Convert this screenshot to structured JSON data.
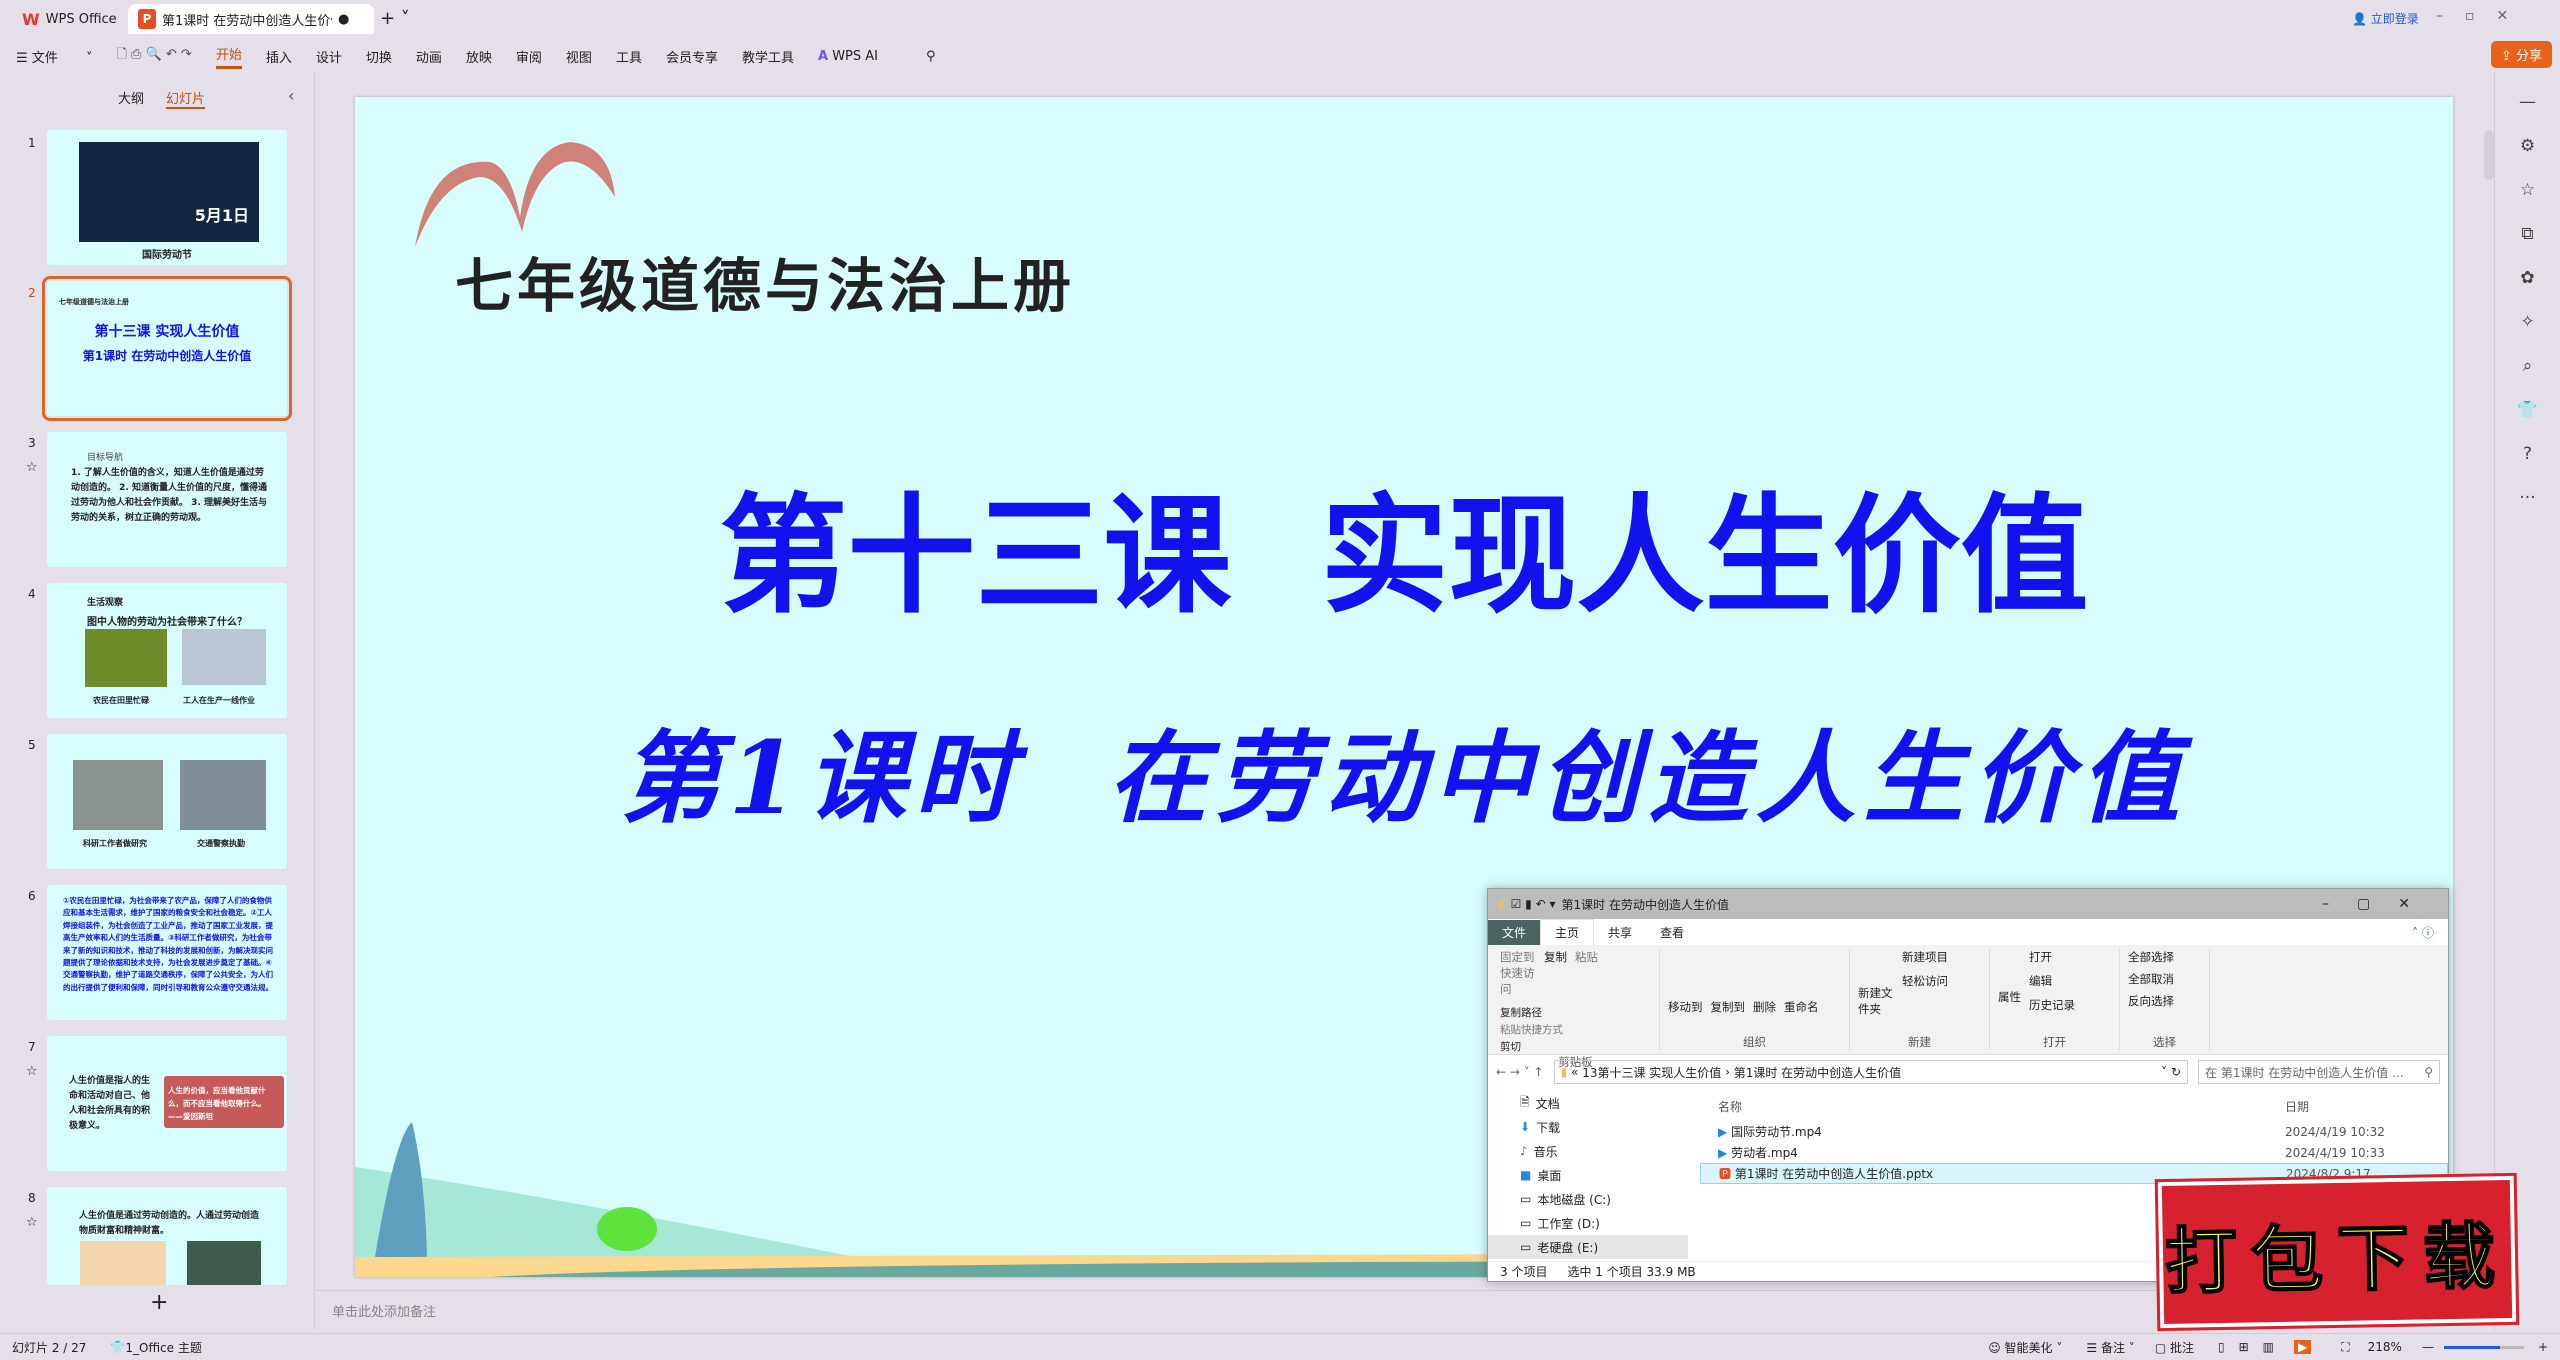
{
  "titlebar": {
    "app": "WPS Office",
    "doc_tab": "第1课时 在劳动中创造人生价值",
    "login": "立即登录"
  },
  "menu": {
    "file": "文件",
    "items": [
      "开始",
      "插入",
      "设计",
      "切换",
      "动画",
      "放映",
      "审阅",
      "视图",
      "工具",
      "会员专享",
      "教学工具"
    ],
    "active": "开始",
    "ai": "WPS AI",
    "share": "分享"
  },
  "panel": {
    "tabs": [
      "大纲",
      "幻灯片"
    ],
    "active_tab": "幻灯片"
  },
  "thumbs": [
    {
      "n": "1",
      "text": "国际劳动节",
      "sub": "5月1日"
    },
    {
      "n": "2",
      "text": "第十三课 实现人生价值",
      "sub": "第1课时 在劳动中创造人生价值",
      "head": "七年级道德与法治上册"
    },
    {
      "n": "3",
      "head": "目标导航",
      "text": "1. 了解人生价值的含义，知道人生价值是通过劳动创造的。 2. 知道衡量人生价值的尺度，懂得通过劳动为他人和社会作贡献。 3. 理解美好生活与劳动的关系，树立正确的劳动观。"
    },
    {
      "n": "4",
      "head": "生活观察",
      "text": "图中人物的劳动为社会带来了什么？",
      "cap1": "农民在田里忙碌",
      "cap2": "工人在生产一线作业"
    },
    {
      "n": "5",
      "cap1": "科研工作者做研究",
      "cap2": "交通警察执勤"
    },
    {
      "n": "6",
      "text": "①农民在田里忙碌，为社会带来了农产品，保障了人们的食物供应和基本生活需求，维护了国家的粮食安全和社会稳定。②工人焊接组装件，为社会创造了工业产品，推动了国家工业发展，提高生产效率和人们的生活质量。③科研工作者做研究，为社会带来了新的知识和技术，推动了科技的发展和创新，为解决现实问题提供了理论依据和技术支持，为社会发展进步奠定了基础。④交通警察执勤，维护了道路交通秩序，保障了公共安全，为人们的出行提供了便利和保障，同时引导和教育公众遵守交通法规。"
    },
    {
      "n": "7",
      "text": "人生价值是指人的生命和活动对自己、他人和社会所具有的积极意义。",
      "quote": "人生的价值，应当看他贡献什么，而不应当看他取得什么。 ——爱因斯坦"
    },
    {
      "n": "8",
      "text": "人生价值是通过劳动创造的。人通过劳动创造物质财富和精神财富。"
    }
  ],
  "slide": {
    "header": "七年级道德与法治上册",
    "title": "第十三课  实现人生价值",
    "subtitle": "第1课时  在劳动中创造人生价值",
    "title_color": "#1212ee"
  },
  "notes_placeholder": "单击此处添加备注",
  "status": {
    "slide": "幻灯片 2 / 27",
    "theme": "1_Office 主题",
    "beautify": "智能美化",
    "notes": "备注",
    "comment": "批注",
    "zoom": "218%",
    "zoom_level": 0.7
  },
  "explorer": {
    "title": "第1课时 在劳动中创造人生价值",
    "tabs": [
      "文件",
      "主页",
      "共享",
      "查看"
    ],
    "groups": [
      {
        "label": "剪贴板",
        "items": [
          "固定到快速访问",
          "复制",
          "粘贴",
          "复制路径",
          "粘贴快捷方式",
          "剪切"
        ]
      },
      {
        "label": "组织",
        "items": [
          "移动到",
          "复制到",
          "删除",
          "重命名"
        ]
      },
      {
        "label": "新建",
        "items": [
          "新建文件夹",
          "新建项目",
          "轻松访问"
        ]
      },
      {
        "label": "打开",
        "items": [
          "属性",
          "打开",
          "编辑",
          "历史记录"
        ]
      },
      {
        "label": "选择",
        "items": [
          "全部选择",
          "全部取消",
          "反向选择"
        ]
      }
    ],
    "path": [
      "13第十三课 实现人生价值",
      "第1课时 在劳动中创造人生价值"
    ],
    "search": "在 第1课时 在劳动中创造人生价值 ...",
    "nav": [
      "文档",
      "下载",
      "音乐",
      "桌面",
      "本地磁盘 (C:)",
      "工作室 (D:)",
      "老硬盘 (E:)"
    ],
    "columns": [
      "名称",
      "日期"
    ],
    "files": [
      {
        "name": "国际劳动节.mp4",
        "date": "2024/4/19 10:32"
      },
      {
        "name": "劳动者.mp4",
        "date": "2024/4/19 10:33"
      },
      {
        "name": "第1课时 在劳动中创造人生价值.pptx",
        "date": "2024/8/2 9:17"
      }
    ],
    "status": [
      "3 个项目",
      "选中 1 个项目  33.9 MB"
    ]
  },
  "stamp": "打包下载"
}
